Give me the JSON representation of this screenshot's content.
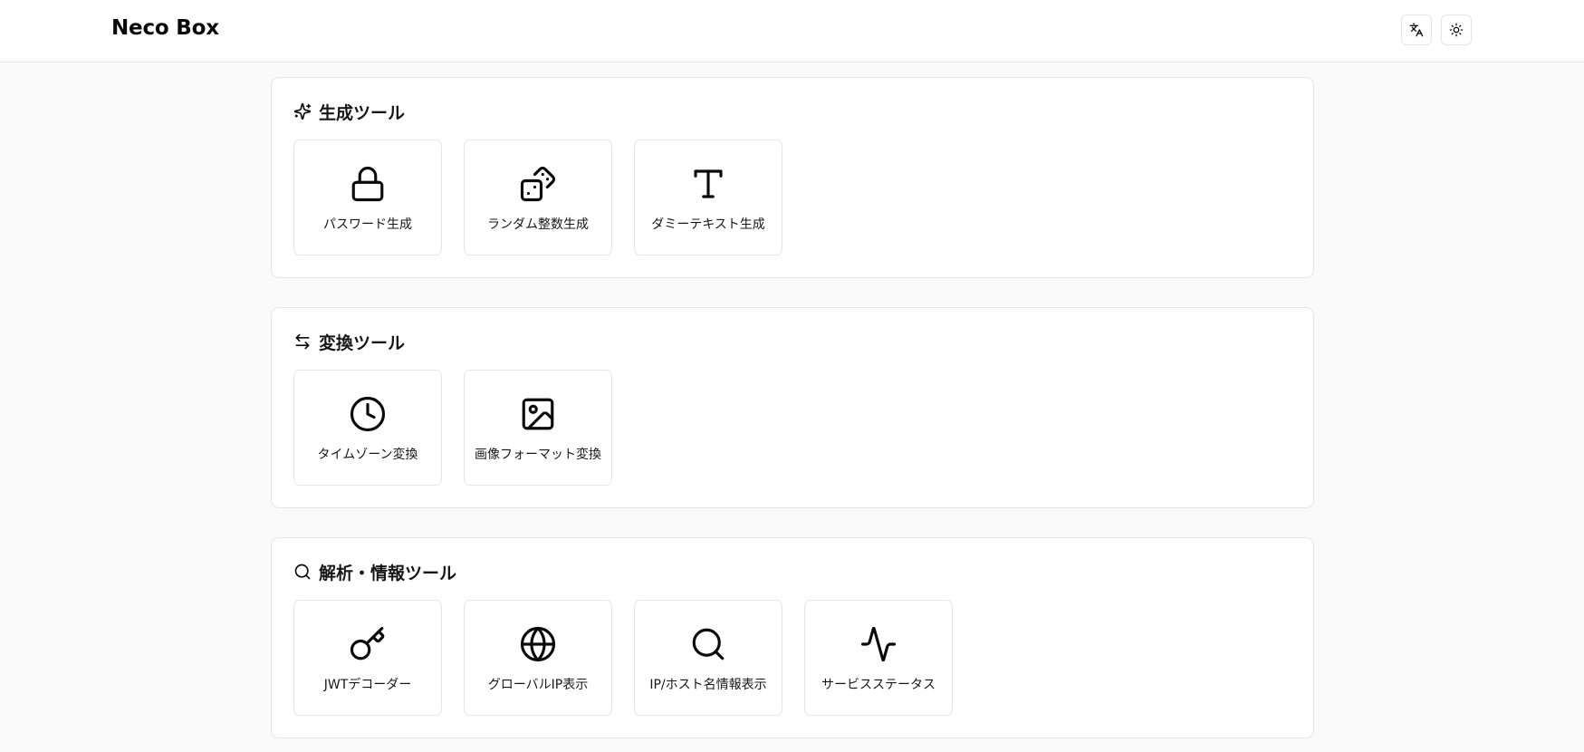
{
  "app": {
    "title": "Neco Box"
  },
  "header": {
    "language_button_icon": "language-icon",
    "theme_button_icon": "sun-icon"
  },
  "sections": [
    {
      "title": "生成ツール",
      "icon": "sparkles-icon",
      "tools": [
        {
          "label": "パスワード生成",
          "icon": "lock-icon"
        },
        {
          "label": "ランダム整数生成",
          "icon": "dices-icon"
        },
        {
          "label": "ダミーテキスト生成",
          "icon": "type-icon"
        }
      ]
    },
    {
      "title": "変換ツール",
      "icon": "arrow-left-right-icon",
      "tools": [
        {
          "label": "タイムゾーン変換",
          "icon": "clock-icon"
        },
        {
          "label": "画像フォーマット変換",
          "icon": "image-icon"
        }
      ]
    },
    {
      "title": "解析・情報ツール",
      "icon": "search-icon",
      "tools": [
        {
          "label": "JWTデコーダー",
          "icon": "key-icon"
        },
        {
          "label": "グローバルIP表示",
          "icon": "globe-icon"
        },
        {
          "label": "IP/ホスト名情報表示",
          "icon": "search-icon"
        },
        {
          "label": "サービスステータス",
          "icon": "activity-icon"
        }
      ]
    }
  ]
}
